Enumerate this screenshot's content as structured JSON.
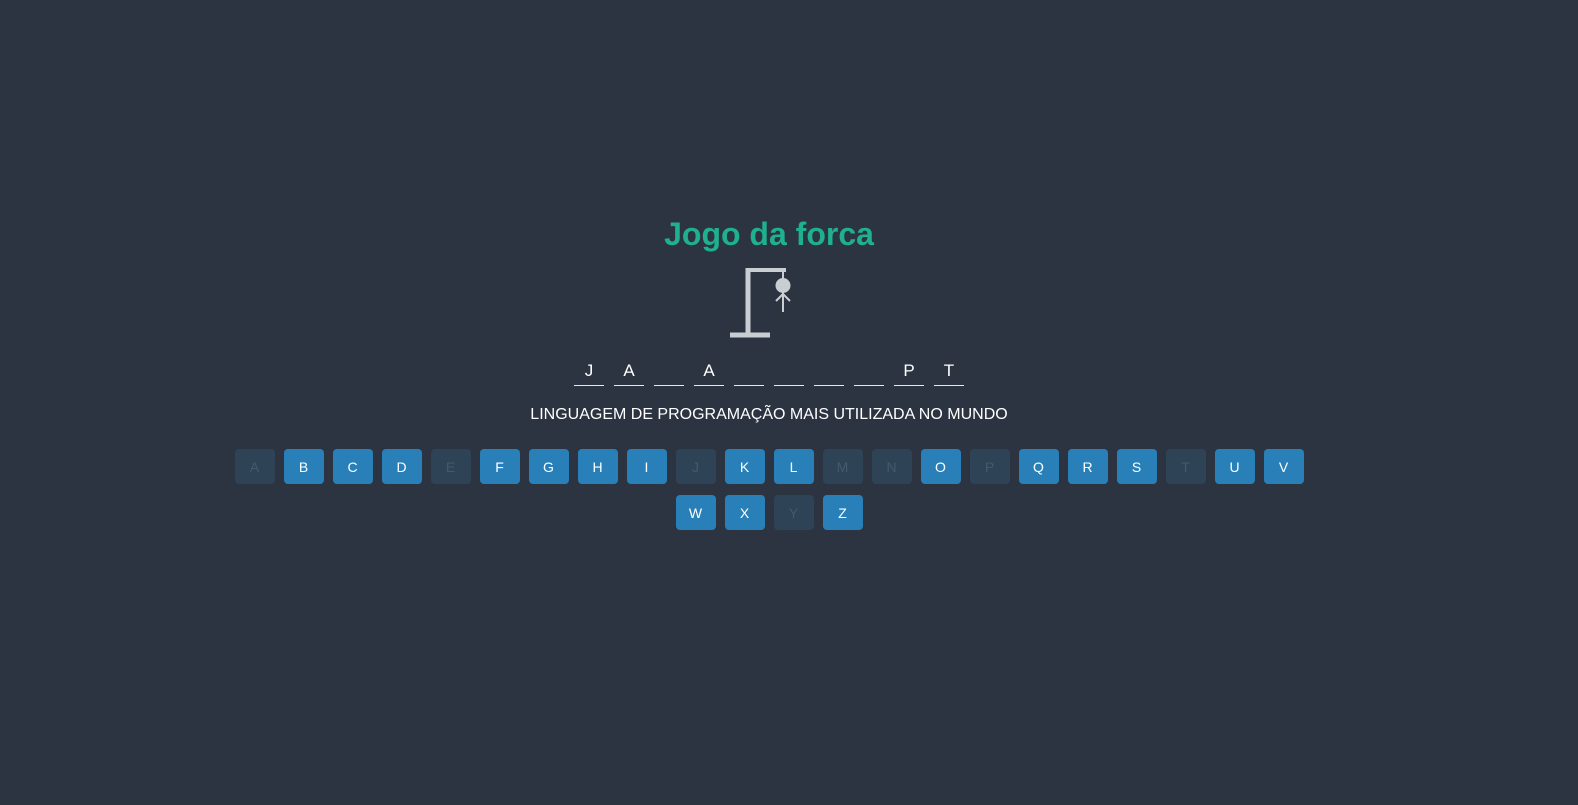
{
  "title": "Jogo da forca",
  "word": {
    "letters": [
      "J",
      "A",
      "",
      "A",
      "",
      "",
      "",
      "",
      "P",
      "T"
    ]
  },
  "hint": "LINGUAGEM DE PROGRAMAÇÃO MAIS UTILIZADA NO MUNDO",
  "keyboard": {
    "keys": [
      {
        "label": "A",
        "used": true
      },
      {
        "label": "B",
        "used": false
      },
      {
        "label": "C",
        "used": false
      },
      {
        "label": "D",
        "used": false
      },
      {
        "label": "E",
        "used": true
      },
      {
        "label": "F",
        "used": false
      },
      {
        "label": "G",
        "used": false
      },
      {
        "label": "H",
        "used": false
      },
      {
        "label": "I",
        "used": false
      },
      {
        "label": "J",
        "used": true
      },
      {
        "label": "K",
        "used": false
      },
      {
        "label": "L",
        "used": false
      },
      {
        "label": "M",
        "used": true
      },
      {
        "label": "N",
        "used": true
      },
      {
        "label": "O",
        "used": false
      },
      {
        "label": "P",
        "used": true
      },
      {
        "label": "Q",
        "used": false
      },
      {
        "label": "R",
        "used": false
      },
      {
        "label": "S",
        "used": false
      },
      {
        "label": "T",
        "used": true
      },
      {
        "label": "U",
        "used": false
      },
      {
        "label": "V",
        "used": false
      },
      {
        "label": "W",
        "used": false
      },
      {
        "label": "X",
        "used": false
      },
      {
        "label": "Y",
        "used": true
      },
      {
        "label": "Z",
        "used": false
      }
    ]
  },
  "colors": {
    "background": "#2b3440",
    "title": "#1fb08f",
    "key_active": "#2980b9",
    "key_used": "#2e4456",
    "gallows": "#c9ced3"
  }
}
